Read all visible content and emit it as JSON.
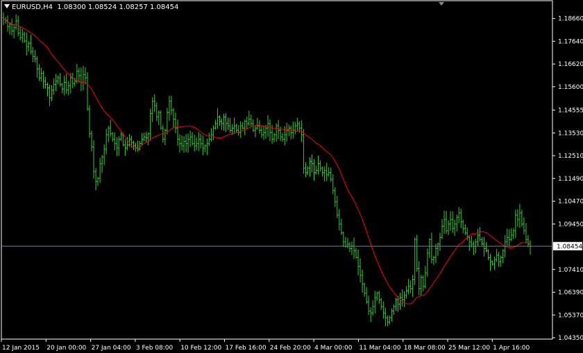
{
  "header": {
    "symbol": "EURUSD,H4",
    "open": "1.08300",
    "high": "1.08524",
    "low": "1.08257",
    "close": "1.08454"
  },
  "colors": {
    "background": "#000000",
    "bars": "#32cd32",
    "moving_average": "#ff0000",
    "current_price_line": "#708090",
    "axis": "#ffffff"
  },
  "chart_data": {
    "type": "line",
    "subtype": "ohlc-bars",
    "ylim": [
      1.0435,
      1.1932
    ],
    "yticks": [
      "1.18660",
      "1.17640",
      "1.16620",
      "1.15600",
      "1.14555",
      "1.13530",
      "1.12510",
      "1.11490",
      "1.10470",
      "1.09450",
      "1.07410",
      "1.06390",
      "1.05370",
      "1.04350"
    ],
    "xticks": [
      "12 Jan 2015",
      "20 Jan 00:00",
      "27 Jan 04:00",
      "3 Feb 08:00",
      "10 Feb 12:00",
      "17 Feb 16:00",
      "24 Feb 20:00",
      "4 Mar 00:00",
      "11 Mar 04:00",
      "18 Mar 08:00",
      "25 Mar 12:00",
      "1 Apr 16:00"
    ],
    "current_price": "1.08454",
    "price_path": [
      1.1862,
      1.1858,
      1.183,
      1.184,
      1.181,
      1.1825,
      1.1855,
      1.18,
      1.178,
      1.1795,
      1.1765,
      1.174,
      1.1755,
      1.1718,
      1.1695,
      1.1685,
      1.164,
      1.16,
      1.162,
      1.1585,
      1.157,
      1.1555,
      1.151,
      1.1545,
      1.157,
      1.1585,
      1.16,
      1.157,
      1.155,
      1.158,
      1.1545,
      1.1565,
      1.16,
      1.1575,
      1.1585,
      1.163,
      1.161,
      1.158,
      1.1615,
      1.16,
      1.146,
      1.135,
      1.129,
      1.118,
      1.1135,
      1.115,
      1.1215,
      1.1245,
      1.128,
      1.1345,
      1.1375,
      1.135,
      1.1325,
      1.1305,
      1.1285,
      1.1325,
      1.1345,
      1.13,
      1.1285,
      1.13,
      1.1325,
      1.131,
      1.1295,
      1.1285,
      1.128,
      1.1305,
      1.1325,
      1.1335,
      1.133,
      1.135,
      1.144,
      1.1495,
      1.1475,
      1.1425,
      1.1445,
      1.1375,
      1.1325,
      1.1365,
      1.1445,
      1.1495,
      1.1455,
      1.1415,
      1.1375,
      1.1325,
      1.1305,
      1.1295,
      1.1315,
      1.1305,
      1.1325,
      1.1335,
      1.1305,
      1.1295,
      1.1305,
      1.1325,
      1.1305,
      1.1285,
      1.1295,
      1.1305,
      1.1325,
      1.1345,
      1.1375,
      1.1395,
      1.1425,
      1.1405,
      1.1395,
      1.1425,
      1.1395,
      1.1385,
      1.1365,
      1.1375,
      1.1385,
      1.1365,
      1.1355,
      1.1385,
      1.1375,
      1.1405,
      1.1395,
      1.1415,
      1.1395,
      1.1365,
      1.1375,
      1.1385,
      1.1365,
      1.1345,
      1.1355,
      1.1375,
      1.1395,
      1.1355,
      1.1325,
      1.1345,
      1.1385,
      1.1365,
      1.1335,
      1.1325,
      1.1345,
      1.1365,
      1.1375,
      1.1355,
      1.1365,
      1.1385,
      1.1395,
      1.1375,
      1.1345,
      1.1195,
      1.1175,
      1.1195,
      1.1225,
      1.1215,
      1.1175,
      1.1185,
      1.1215,
      1.1195,
      1.1175,
      1.1185,
      1.1165,
      1.1175,
      1.1145,
      1.1095,
      1.1045,
      1.0985,
      1.0945,
      1.0905,
      1.0865,
      1.0845,
      1.0855,
      1.0835,
      1.0845,
      1.0825,
      1.0795,
      1.0755,
      1.0715,
      1.0675,
      1.0635,
      1.0595,
      1.0555,
      1.0545,
      1.0575,
      1.0615,
      1.0635,
      1.0605,
      1.0575,
      1.0545,
      1.0525,
      1.0505,
      1.0525,
      1.0555,
      1.0575,
      1.0605,
      1.0585,
      1.0615,
      1.0605,
      1.0625,
      1.0645,
      1.0665,
      1.0655,
      1.0695,
      1.0875,
      1.0745,
      1.0655,
      1.0705,
      1.0665,
      1.0725,
      1.0815,
      1.0875,
      1.0785,
      1.0795,
      1.0835,
      1.0855,
      1.0885,
      1.0935,
      1.0965,
      1.0915,
      1.0945,
      1.0965,
      1.0925,
      1.0945,
      1.0975,
      1.0995,
      1.0955,
      1.0925,
      1.0905,
      1.0885,
      1.0865,
      1.0855,
      1.0845,
      1.0865,
      1.0895,
      1.0875,
      1.0855,
      1.0835,
      1.0825,
      1.0795,
      1.0775,
      1.0765,
      1.0785,
      1.0805,
      1.0775,
      1.0795,
      1.0825,
      1.0865,
      1.0885,
      1.0875,
      1.0895,
      1.0915,
      1.0985,
      1.0965,
      1.0995,
      1.0945,
      1.0915,
      1.0875,
      1.0855,
      1.0845
    ]
  }
}
